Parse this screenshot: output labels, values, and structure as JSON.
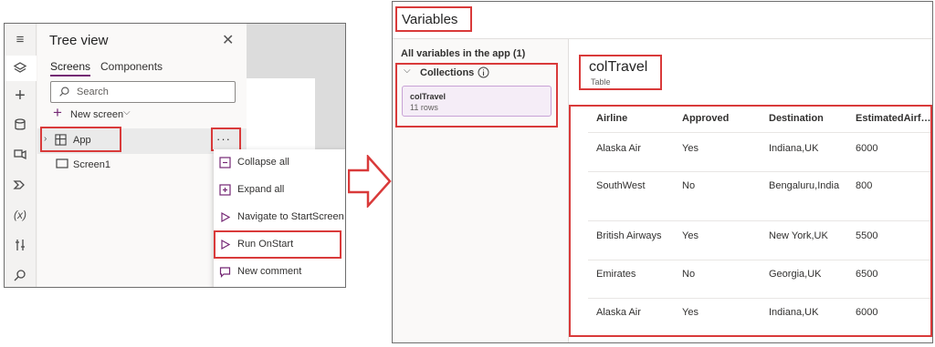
{
  "tree_view": {
    "title": "Tree view",
    "tabs": [
      "Screens",
      "Components"
    ],
    "search_placeholder": "Search",
    "new_screen_label": "New screen",
    "items": [
      {
        "label": "App"
      },
      {
        "label": "Screen1"
      }
    ],
    "more_label": "···"
  },
  "context_menu": {
    "items": [
      {
        "label": "Collapse all",
        "icon": "collapse-icon"
      },
      {
        "label": "Expand all",
        "icon": "expand-icon"
      },
      {
        "label": "Navigate to StartScreen",
        "icon": "play-icon"
      },
      {
        "label": "Run OnStart",
        "icon": "play-icon"
      },
      {
        "label": "New comment",
        "icon": "comment-icon"
      }
    ]
  },
  "rail": {
    "icons": [
      "hamburger-icon",
      "layers-icon",
      "plus-icon",
      "database-icon",
      "media-icon",
      "flow-icon",
      "variables-icon",
      "tools-icon",
      "search-icon"
    ],
    "variables_glyph": "(x)"
  },
  "variables": {
    "title": "Variables",
    "all_label": "All variables in the app (1)",
    "collections_label": "Collections",
    "card": {
      "name": "colTravel",
      "rows": "11 rows"
    },
    "selected": {
      "name": "colTravel",
      "type": "Table"
    },
    "table": {
      "columns": [
        "Airline",
        "Approved",
        "Destination",
        "EstimatedAirf…"
      ],
      "rows": [
        [
          "Alaska Air",
          "Yes",
          "Indiana,UK",
          "6000"
        ],
        [
          "SouthWest",
          "No",
          "Bengaluru,India",
          "800"
        ],
        [
          "British Airways",
          "Yes",
          "New York,UK",
          "5500"
        ],
        [
          "Emirates",
          "No",
          "Georgia,UK",
          "6500"
        ],
        [
          "Alaska Air",
          "Yes",
          "Indiana,UK",
          "6000"
        ]
      ]
    }
  },
  "colors": {
    "highlight": "#d93a3a",
    "accent": "#742774",
    "card_bg": "#f5edf7"
  }
}
